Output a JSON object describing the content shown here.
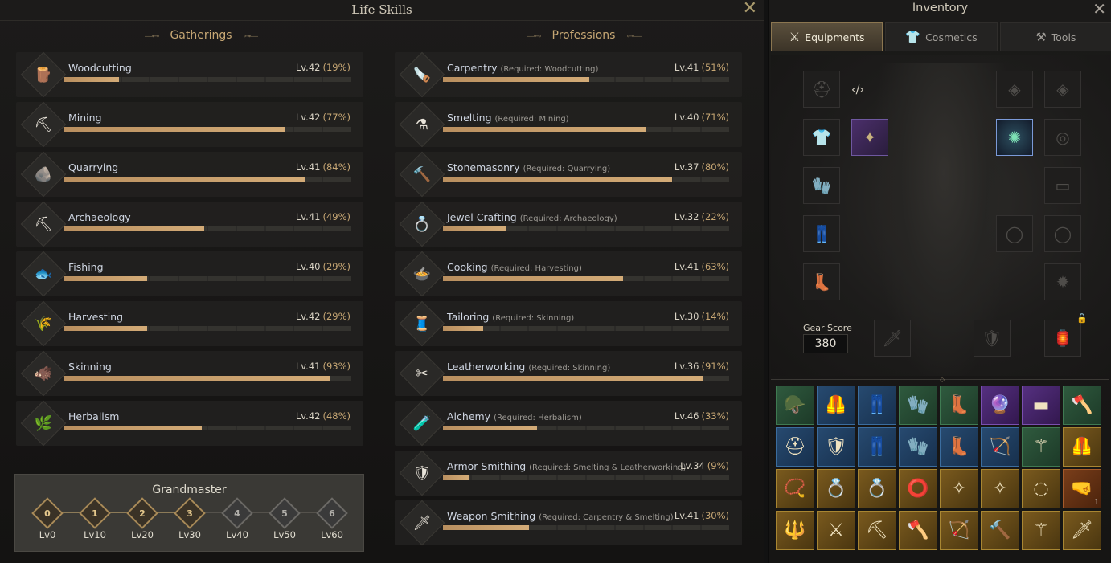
{
  "life_skills": {
    "title": "Life Skills",
    "gatherings_label": "Gatherings",
    "professions_label": "Professions",
    "gatherings": [
      {
        "name": "Woodcutting",
        "level": "Lv.42",
        "pct": "(19%)",
        "progress": 0.19,
        "icon": "woodcutting-icon",
        "glyph": "🪵"
      },
      {
        "name": "Mining",
        "level": "Lv.42",
        "pct": "(77%)",
        "progress": 0.77,
        "icon": "mining-icon",
        "glyph": "⛏"
      },
      {
        "name": "Quarrying",
        "level": "Lv.41",
        "pct": "(84%)",
        "progress": 0.84,
        "icon": "quarrying-icon",
        "glyph": "🪨"
      },
      {
        "name": "Archaeology",
        "level": "Lv.41",
        "pct": "(49%)",
        "progress": 0.49,
        "icon": "archaeology-icon",
        "glyph": "⛏"
      },
      {
        "name": "Fishing",
        "level": "Lv.40",
        "pct": "(29%)",
        "progress": 0.29,
        "icon": "fishing-icon",
        "glyph": "🐟"
      },
      {
        "name": "Harvesting",
        "level": "Lv.42",
        "pct": "(29%)",
        "progress": 0.29,
        "icon": "harvesting-icon",
        "glyph": "🌾"
      },
      {
        "name": "Skinning",
        "level": "Lv.41",
        "pct": "(93%)",
        "progress": 0.93,
        "icon": "skinning-icon",
        "glyph": "🐗"
      },
      {
        "name": "Herbalism",
        "level": "Lv.42",
        "pct": "(48%)",
        "progress": 0.48,
        "icon": "herbalism-icon",
        "glyph": "🌿"
      }
    ],
    "professions": [
      {
        "name": "Carpentry",
        "req": "(Required: Woodcutting)",
        "level": "Lv.41",
        "pct": "(51%)",
        "progress": 0.51,
        "icon": "carpentry-icon",
        "glyph": "🪚"
      },
      {
        "name": "Smelting",
        "req": "(Required: Mining)",
        "level": "Lv.40",
        "pct": "(71%)",
        "progress": 0.71,
        "icon": "smelting-icon",
        "glyph": "⚗"
      },
      {
        "name": "Stonemasonry",
        "req": "(Required: Quarrying)",
        "level": "Lv.37",
        "pct": "(80%)",
        "progress": 0.8,
        "icon": "stonemasonry-icon",
        "glyph": "🔨"
      },
      {
        "name": "Jewel Crafting",
        "req": "(Required: Archaeology)",
        "level": "Lv.32",
        "pct": "(22%)",
        "progress": 0.22,
        "icon": "jewel-crafting-icon",
        "glyph": "💍"
      },
      {
        "name": "Cooking",
        "req": "(Required: Harvesting)",
        "level": "Lv.41",
        "pct": "(63%)",
        "progress": 0.63,
        "icon": "cooking-icon",
        "glyph": "🍲"
      },
      {
        "name": "Tailoring",
        "req": "(Required: Skinning)",
        "level": "Lv.30",
        "pct": "(14%)",
        "progress": 0.14,
        "icon": "tailoring-icon",
        "glyph": "🧵"
      },
      {
        "name": "Leatherworking",
        "req": "(Required: Skinning)",
        "level": "Lv.36",
        "pct": "(91%)",
        "progress": 0.91,
        "icon": "leatherworking-icon",
        "glyph": "✂"
      },
      {
        "name": "Alchemy",
        "req": "(Required: Herbalism)",
        "level": "Lv.46",
        "pct": "(33%)",
        "progress": 0.33,
        "icon": "alchemy-icon",
        "glyph": "🧪"
      },
      {
        "name": "Armor Smithing",
        "req": "(Required: Smelting & Leatherworking)",
        "level": "Lv.34",
        "pct": "(9%)",
        "progress": 0.09,
        "icon": "armor-smithing-icon",
        "glyph": "🛡"
      },
      {
        "name": "Weapon Smithing",
        "req": "(Required: Carpentry & Smelting)",
        "level": "Lv.41",
        "pct": "(30%)",
        "progress": 0.3,
        "icon": "weapon-smithing-icon",
        "glyph": "🗡"
      }
    ],
    "grandmaster": {
      "title": "Grandmaster",
      "tiers": [
        {
          "num": "0",
          "label": "Lv0",
          "achieved": true
        },
        {
          "num": "1",
          "label": "Lv10",
          "achieved": true
        },
        {
          "num": "2",
          "label": "Lv20",
          "achieved": true
        },
        {
          "num": "3",
          "label": "Lv30",
          "achieved": true
        },
        {
          "num": "4",
          "label": "Lv40",
          "achieved": false
        },
        {
          "num": "5",
          "label": "Lv50",
          "achieved": false
        },
        {
          "num": "6",
          "label": "Lv60",
          "achieved": false
        }
      ]
    }
  },
  "inventory": {
    "title": "Inventory",
    "tabs": [
      {
        "label": "Equipments",
        "icon": "equipment-icon",
        "glyph": "⚔",
        "active": true
      },
      {
        "label": "Cosmetics",
        "icon": "cosmetics-icon",
        "glyph": "👕",
        "active": false
      },
      {
        "label": "Tools",
        "icon": "tools-icon",
        "glyph": "⚒",
        "active": false
      }
    ],
    "gear_score_label": "Gear Score",
    "gear_score": "380",
    "equip_slots": [
      {
        "name": "helmet-slot",
        "glyph": "⛑",
        "filled": false
      },
      {
        "name": "chest-slot",
        "glyph": "👕",
        "filled": false
      },
      {
        "name": "gloves-slot",
        "glyph": "🧤",
        "filled": false
      },
      {
        "name": "pants-slot",
        "glyph": "👖",
        "filled": false
      },
      {
        "name": "boots-slot",
        "glyph": "👢",
        "filled": false
      },
      {
        "name": "cloak-slot",
        "glyph": "✦",
        "filled": "purple"
      },
      {
        "name": "trinket-slot-1",
        "glyph": "◈",
        "filled": false
      },
      {
        "name": "trinket-slot-2",
        "glyph": "◈",
        "filled": false
      },
      {
        "name": "amulet-slot",
        "glyph": "✺",
        "filled": "blue"
      },
      {
        "name": "earring-slot",
        "glyph": "◎",
        "filled": false
      },
      {
        "name": "belt-slot",
        "glyph": "▭",
        "filled": false
      },
      {
        "name": "ring-slot-1",
        "glyph": "◯",
        "filled": false
      },
      {
        "name": "ring-slot-2",
        "glyph": "◯",
        "filled": false
      },
      {
        "name": "bracelet-slot",
        "glyph": "✹",
        "filled": false
      },
      {
        "name": "main-weapon-slot",
        "glyph": "🗡",
        "filled": false
      },
      {
        "name": "offhand-slot",
        "glyph": "🛡",
        "filled": false
      },
      {
        "name": "lantern-slot",
        "glyph": "🏮",
        "filled": false
      }
    ],
    "items": [
      {
        "name": "leather-hood",
        "rarity": "green",
        "glyph": "🪖"
      },
      {
        "name": "armor-chest",
        "rarity": "blue",
        "glyph": "🦺"
      },
      {
        "name": "armor-leggings",
        "rarity": "blue",
        "glyph": "👖"
      },
      {
        "name": "crossed-gauntlets",
        "rarity": "green",
        "glyph": "🧤"
      },
      {
        "name": "armored-boots",
        "rarity": "green",
        "glyph": "👢"
      },
      {
        "name": "ornate-amulet",
        "rarity": "purple",
        "glyph": "🔮"
      },
      {
        "name": "belt",
        "rarity": "purple",
        "glyph": "▬"
      },
      {
        "name": "battle-axe",
        "rarity": "green",
        "glyph": "🪓"
      },
      {
        "name": "gold-helmet",
        "rarity": "blue",
        "glyph": "⛑"
      },
      {
        "name": "gold-chestplate",
        "rarity": "blue",
        "glyph": "🛡"
      },
      {
        "name": "gold-leggings",
        "rarity": "blue",
        "glyph": "👖"
      },
      {
        "name": "gold-gauntlets",
        "rarity": "blue",
        "glyph": "🧤"
      },
      {
        "name": "gold-boots",
        "rarity": "blue",
        "glyph": "👢"
      },
      {
        "name": "crossbow",
        "rarity": "blue",
        "glyph": "🏹"
      },
      {
        "name": "staff",
        "rarity": "green",
        "glyph": "⚚"
      },
      {
        "name": "gold-armor",
        "rarity": "gold",
        "glyph": "🦺"
      },
      {
        "name": "gem-necklace",
        "rarity": "gold",
        "glyph": "📿"
      },
      {
        "name": "fire-ring",
        "rarity": "gold",
        "glyph": "💍"
      },
      {
        "name": "fire-ring-2",
        "rarity": "gold",
        "glyph": "💍"
      },
      {
        "name": "gem-bracelet",
        "rarity": "gold",
        "glyph": "⭕"
      },
      {
        "name": "earring",
        "rarity": "gold",
        "glyph": "✧"
      },
      {
        "name": "earring-2",
        "rarity": "gold",
        "glyph": "✧"
      },
      {
        "name": "gold-bracelet",
        "rarity": "gold",
        "glyph": "◌"
      },
      {
        "name": "golden-gauntlet",
        "rarity": "orange",
        "glyph": "🤜",
        "qty": "1"
      },
      {
        "name": "golden-spear",
        "rarity": "gold",
        "glyph": "🔱"
      },
      {
        "name": "scythe",
        "rarity": "gold",
        "glyph": "⚔"
      },
      {
        "name": "pickaxe",
        "rarity": "gold",
        "glyph": "⛏"
      },
      {
        "name": "double-axe",
        "rarity": "gold",
        "glyph": "🪓"
      },
      {
        "name": "golden-bow",
        "rarity": "gold",
        "glyph": "🏹"
      },
      {
        "name": "war-hammer",
        "rarity": "gold",
        "glyph": "🔨"
      },
      {
        "name": "ornate-staff",
        "rarity": "gold",
        "glyph": "⚚"
      },
      {
        "name": "curved-blade",
        "rarity": "gold",
        "glyph": "🗡"
      }
    ]
  }
}
